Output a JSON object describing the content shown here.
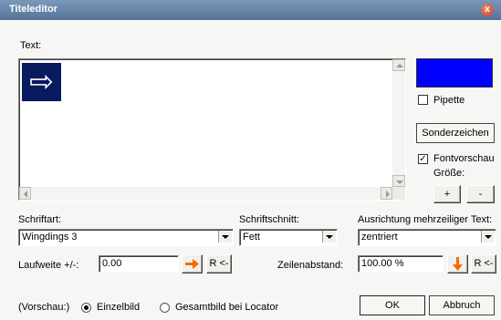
{
  "window": {
    "title": "Titeleditor",
    "close_glyph": "x"
  },
  "text_label": "Text:",
  "editor": {
    "preview_glyph": "⇨",
    "preview_icon": "arrow-right-icon",
    "preview_bg": "#0a1a5e"
  },
  "color_swatch": "#0000ff",
  "pipette": {
    "label": "Pipette",
    "checked": false
  },
  "sonderzeichen_label": "Sonderzeichen",
  "fontvorschau": {
    "label": "Fontvorschau",
    "checked": true,
    "check_glyph": "✓"
  },
  "groesse": {
    "label": "Größe:",
    "plus": "+",
    "minus": "-"
  },
  "schriftart": {
    "label": "Schriftart:",
    "value": "Wingdings 3"
  },
  "schriftschnitt": {
    "label": "Schriftschnitt:",
    "value": "Fett"
  },
  "ausrichtung": {
    "label": "Ausrichtung mehrzeiliger Text:",
    "value": "zentriert"
  },
  "laufweite": {
    "label": "Laufweite +/-:",
    "value": "0.00",
    "reset": "R <-"
  },
  "zeilenabstand": {
    "label": "Zeilenabstand:",
    "value": "100.00 %",
    "reset": "R <-"
  },
  "vorschau": {
    "label": "(Vorschau:)",
    "einzelbild": "Einzelbild",
    "gesamtbild": "Gesamtbild bei Locator",
    "selected": "einzelbild"
  },
  "ok_label": "OK",
  "abbruch_label": "Abbruch",
  "accent_orange": "#ff6600"
}
